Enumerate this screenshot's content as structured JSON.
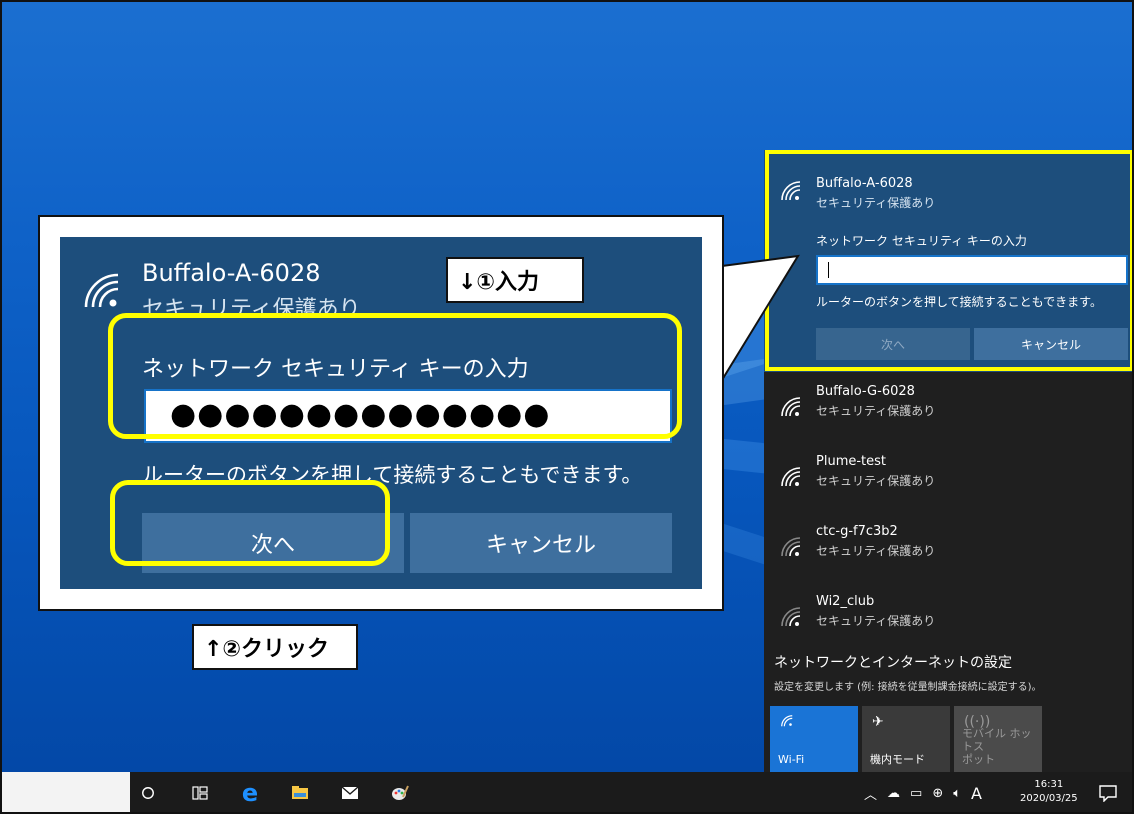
{
  "flyout": {
    "selected_network": {
      "ssid": "Buffalo-A-6028",
      "security": "セキュリティ保護あり",
      "key_label": "ネットワーク セキュリティ キーの入力",
      "hint": "ルーターのボタンを押して接続することもできます。",
      "next_label": "次へ",
      "cancel_label": "キャンセル"
    },
    "networks": [
      {
        "ssid": "Buffalo-G-6028",
        "security": "セキュリティ保護あり"
      },
      {
        "ssid": "Plume-test",
        "security": "セキュリティ保護あり"
      },
      {
        "ssid": "ctc-g-f7c3b2",
        "security": "セキュリティ保護あり"
      },
      {
        "ssid": "Wi2_club",
        "security": "セキュリティ保護あり"
      }
    ],
    "settings_link": "ネットワークとインターネットの設定",
    "settings_sub": "設定を変更します (例: 接続を従量制課金接続に設定する)。",
    "tiles": {
      "wifi": "Wi-Fi",
      "airplane": "機内モード",
      "hotspot_line1": "モバイル ホットス",
      "hotspot_line2": "ポット"
    }
  },
  "zoom": {
    "ssid": "Buffalo-A-6028",
    "security": "セキュリティ保護あり",
    "key_label": "ネットワーク セキュリティ キーの入力",
    "password_mask": "●●●●●●●●●●●●●●",
    "hint": "ルーターのボタンを押して接続することもできます。",
    "next_label": "次へ",
    "cancel_label": "キャンセル"
  },
  "annotations": {
    "step1": "↓①入力",
    "step2": "↑②クリック"
  },
  "taskbar": {
    "time": "16:31",
    "date": "2020/03/25",
    "ime": "A"
  },
  "colors": {
    "accent": "#ffff00",
    "panel_blue": "#1d4e7c",
    "flyout_bg": "#1f1f1f",
    "wifi_tile": "#1a74d6"
  }
}
